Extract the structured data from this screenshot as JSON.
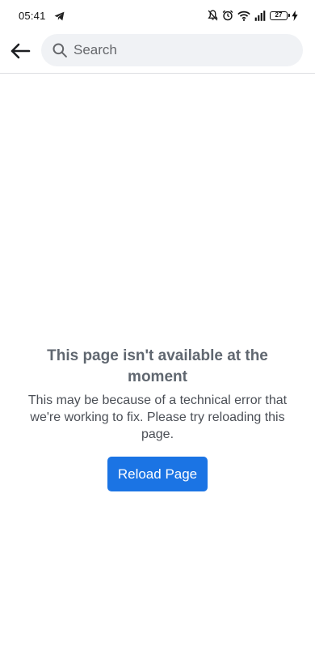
{
  "status_bar": {
    "time": "05:41",
    "battery_level": "27",
    "icons": [
      "telegram-icon",
      "mute-icon",
      "alarm-icon",
      "wifi-icon",
      "signal-icon",
      "battery-icon",
      "charging-icon"
    ]
  },
  "header": {
    "back_icon": "arrow-left-icon",
    "search": {
      "placeholder": "Search",
      "value": ""
    }
  },
  "error": {
    "title": "This page isn't available at the moment",
    "message": "This may be because of a technical error that we're working to fix. Please try reloading this page.",
    "button_label": "Reload Page"
  },
  "colors": {
    "accent": "#1b74e4",
    "title_text": "#606770",
    "body_text": "#4b4f56",
    "search_background": "#f0f2f5",
    "divider": "#dddfe2"
  }
}
